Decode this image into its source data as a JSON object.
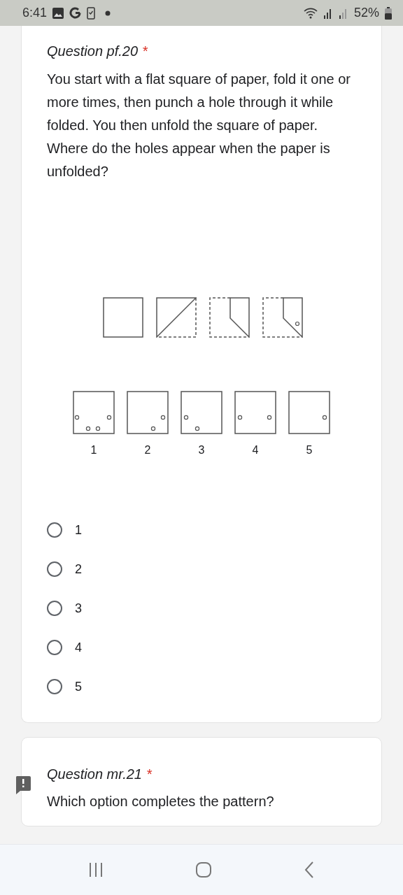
{
  "status_bar": {
    "time": "6:41",
    "battery": "52%"
  },
  "question": {
    "title": "Question pf.20",
    "required_mark": "*",
    "text": "You start with a flat square of paper, fold it one or more times, then punch a hole through it while folded. You then unfold the square of paper. Where do the holes appear when the paper is unfolded?",
    "figure_labels": [
      "1",
      "2",
      "3",
      "4",
      "5"
    ],
    "options": [
      {
        "label": "1",
        "selected": false
      },
      {
        "label": "2",
        "selected": false
      },
      {
        "label": "3",
        "selected": false
      },
      {
        "label": "4",
        "selected": false
      },
      {
        "label": "5",
        "selected": false
      }
    ]
  },
  "next_question": {
    "title": "Question mr.21",
    "required_mark": "*",
    "text": "Which option completes the pattern?"
  }
}
